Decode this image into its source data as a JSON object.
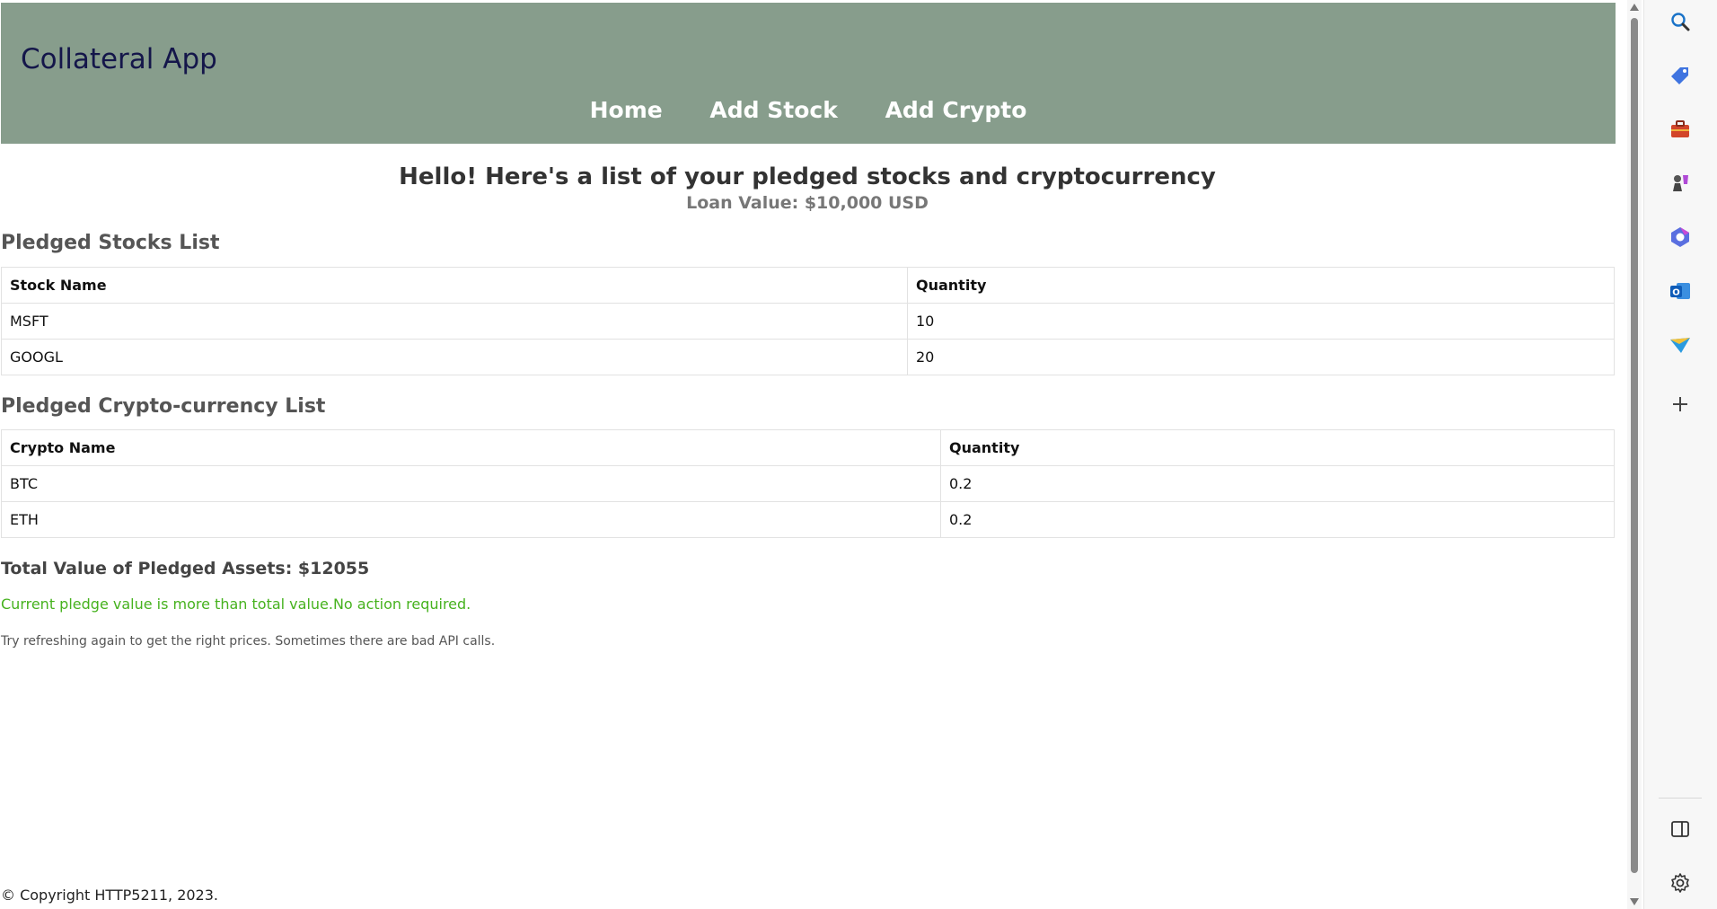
{
  "header": {
    "app_title": "Collateral App",
    "nav": [
      "Home",
      "Add Stock",
      "Add Crypto"
    ]
  },
  "main": {
    "greeting": "Hello! Here's a list of your pledged stocks and cryptocurrency",
    "loan_value": "Loan Value: $10,000 USD",
    "stocks": {
      "heading": "Pledged Stocks List",
      "columns": [
        "Stock Name",
        "Quantity"
      ],
      "rows": [
        [
          "MSFT",
          "10"
        ],
        [
          "GOOGL",
          "20"
        ]
      ]
    },
    "crypto": {
      "heading": "Pledged Crypto-currency List",
      "columns": [
        "Crypto Name",
        "Quantity"
      ],
      "rows": [
        [
          "BTC",
          "0.2"
        ],
        [
          "ETH",
          "0.2"
        ]
      ]
    },
    "total": "Total Value of Pledged Assets: $12055",
    "status_message": "Current pledge value is more than total value.No action required.",
    "hint": "Try refreshing again to get the right prices. Sometimes there are bad API calls."
  },
  "footer": {
    "copyright": "© Copyright HTTP5211, 2023."
  },
  "colors": {
    "header_bg": "#879d8c",
    "title": "#14164a",
    "status_ok": "#46b21e"
  },
  "sidebar": {
    "icons": [
      "search-icon",
      "tag-icon",
      "toolbox-icon",
      "chess-icon",
      "copilot-icon",
      "outlook-icon",
      "send-icon",
      "plus-icon",
      "split-panel-icon",
      "gear-icon"
    ]
  }
}
